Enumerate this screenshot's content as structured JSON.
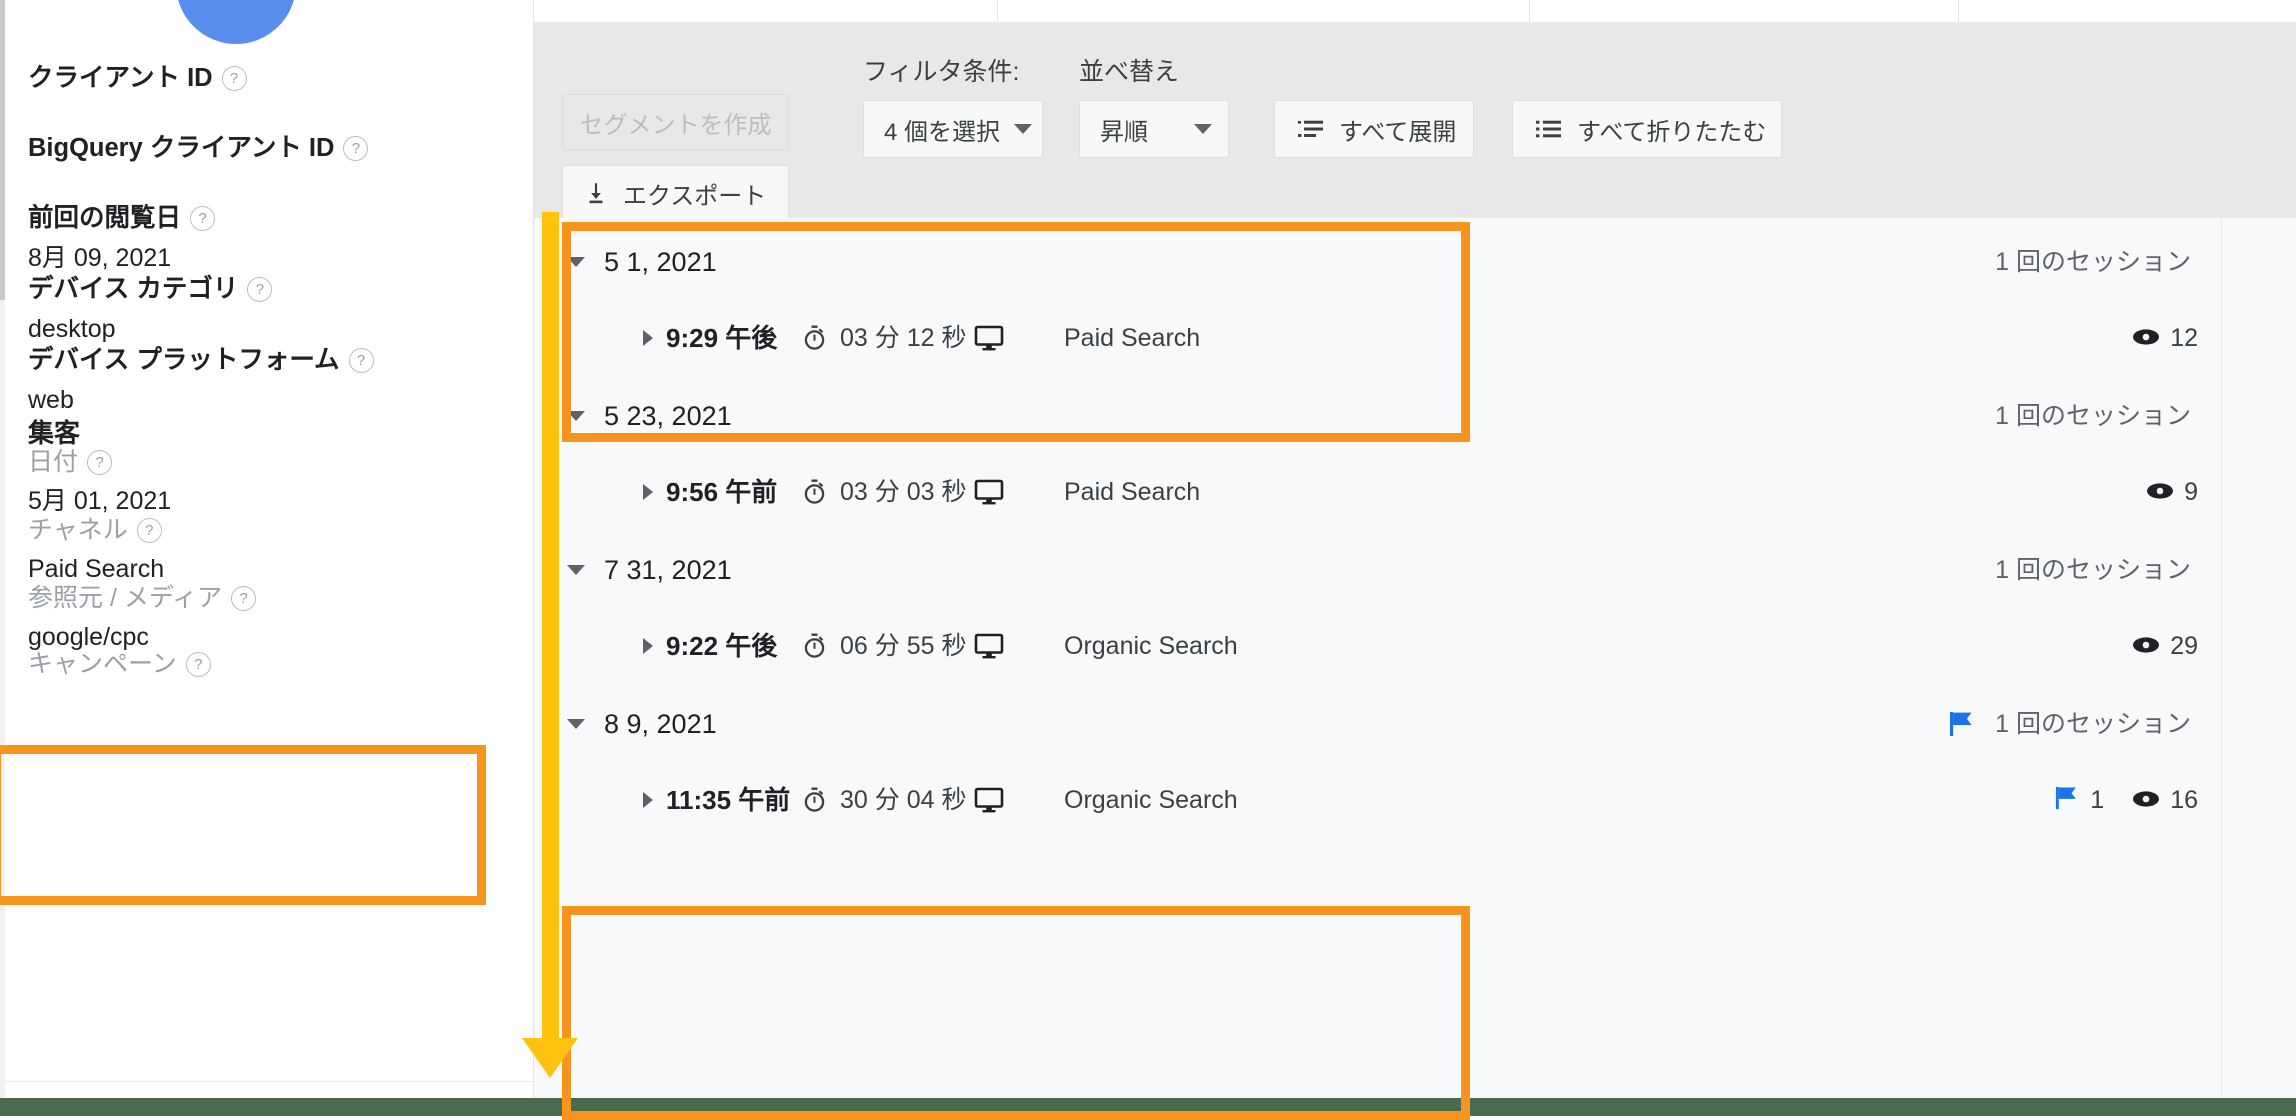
{
  "sidebar": {
    "avatar": "user-avatar",
    "fields": [
      {
        "label": "クライアント ID",
        "help": "?",
        "value": ""
      },
      {
        "label": "BigQuery クライアント ID",
        "help": "?",
        "value": ""
      },
      {
        "label": "前回の閲覧日",
        "help": "?",
        "value": "8月 09, 2021"
      },
      {
        "label": "デバイス カテゴリ",
        "help": "?",
        "value": "desktop"
      },
      {
        "label": "デバイス プラットフォーム",
        "help": "?",
        "value": "web"
      }
    ],
    "acquisition_section": {
      "title": "集客",
      "fields": [
        {
          "label": "日付",
          "help": "?",
          "value": "5月 01, 2021"
        },
        {
          "label": "チャネル",
          "help": "?",
          "value": "Paid Search"
        },
        {
          "label": "参照元 / メディア",
          "help": "?",
          "value": "google/cpc"
        },
        {
          "label": "キャンペーン",
          "help": "?",
          "value": ""
        }
      ]
    }
  },
  "toolbar": {
    "create_segment_label": "セグメントを作成",
    "export_label": "エクスポート",
    "export_icon": "download-icon",
    "filter_label": "フィルタ条件:",
    "filter_value": "4 個を選択",
    "sort_label": "並べ替え",
    "sort_value": "昇順",
    "expand_all_label": "すべて展開",
    "expand_all_icon": "expand-list-icon",
    "collapse_all_label": "すべて折りたたむ",
    "collapse_all_icon": "collapse-list-icon"
  },
  "sessions": [
    {
      "date": "5 1, 2021",
      "session_count_label": "1 回のセッション",
      "has_group_flag": false,
      "rows": [
        {
          "time": "9:29 午後",
          "duration": "03 分 12 秒",
          "device": "desktop-monitor-icon",
          "channel": "Paid Search",
          "flag_count": "",
          "pageview_count": "12"
        }
      ]
    },
    {
      "date": "5 23, 2021",
      "session_count_label": "1 回のセッション",
      "has_group_flag": false,
      "rows": [
        {
          "time": "9:56 午前",
          "duration": "03 分 03 秒",
          "device": "desktop-monitor-icon",
          "channel": "Paid Search",
          "flag_count": "",
          "pageview_count": "9"
        }
      ]
    },
    {
      "date": "7 31, 2021",
      "session_count_label": "1 回のセッション",
      "has_group_flag": false,
      "rows": [
        {
          "time": "9:22 午後",
          "duration": "06 分 55 秒",
          "device": "desktop-monitor-icon",
          "channel": "Organic Search",
          "flag_count": "",
          "pageview_count": "29"
        }
      ]
    },
    {
      "date": "8 9, 2021",
      "session_count_label": "1 回のセッション",
      "has_group_flag": true,
      "rows": [
        {
          "time": "11:35 午前",
          "duration": "30 分 04 秒",
          "device": "desktop-monitor-icon",
          "channel": "Organic Search",
          "flag_count": "1",
          "pageview_count": "16"
        }
      ]
    }
  ],
  "annotations": {
    "box_color": "#F7941D",
    "arrow_color": "#FFC20E",
    "boxes": [
      {
        "name": "sidebar-acquisition-highlight"
      },
      {
        "name": "first-session-highlight"
      },
      {
        "name": "last-session-highlight"
      }
    ],
    "arrow": {
      "name": "downward-arrow"
    }
  },
  "colors": {
    "accent_blue": "#5b8def",
    "flag_blue": "#1a73e8",
    "toolbar_bg": "#e8e8e8",
    "list_bg": "#f8f9fa",
    "bottom_bar": "#4a6b4c"
  }
}
